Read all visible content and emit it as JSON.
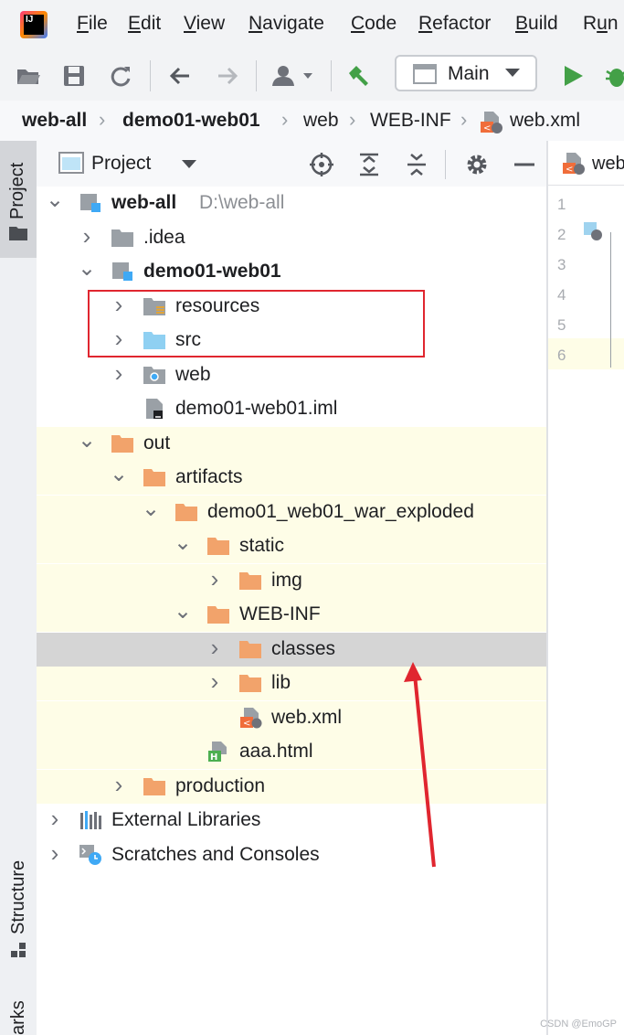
{
  "menu": {
    "app_logo": "IJ",
    "items": [
      {
        "pre": "",
        "ul": "F",
        "post": "ile"
      },
      {
        "pre": "",
        "ul": "E",
        "post": "dit"
      },
      {
        "pre": "",
        "ul": "V",
        "post": "iew"
      },
      {
        "pre": "",
        "ul": "N",
        "post": "avigate"
      },
      {
        "pre": "",
        "ul": "C",
        "post": "ode"
      },
      {
        "pre": "",
        "ul": "R",
        "post": "efactor"
      },
      {
        "pre": "",
        "ul": "B",
        "post": "uild"
      },
      {
        "pre": "R",
        "ul": "u",
        "post": "n"
      }
    ]
  },
  "toolbar": {
    "run_config": "Main",
    "icons": [
      "open-folder-icon",
      "save-icon",
      "sync-icon",
      "back-arrow-icon",
      "forward-arrow-icon",
      "user-icon",
      "build-hammer-icon",
      "run-icon",
      "debug-icon"
    ]
  },
  "breadcrumb": [
    "web-all",
    "demo01-web01",
    "web",
    "WEB-INF",
    "web.xml"
  ],
  "side_tabs": {
    "project": "Project",
    "structure": "Structure",
    "bookmarks": "arks"
  },
  "project_panel": {
    "title": "Project"
  },
  "tree": [
    {
      "label": "web-all",
      "hint": "D:\\web-all",
      "bold": true,
      "chevron": "expanded",
      "icon": "module"
    },
    {
      "label": ".idea",
      "chevron": "collapsed",
      "icon": "folder-gray"
    },
    {
      "label": "demo01-web01",
      "bold": true,
      "chevron": "expanded",
      "icon": "module"
    },
    {
      "label": "resources",
      "chevron": "collapsed",
      "icon": "resources-folder"
    },
    {
      "label": "src",
      "chevron": "collapsed",
      "icon": "source-folder"
    },
    {
      "label": "web",
      "chevron": "collapsed",
      "icon": "web-folder"
    },
    {
      "label": "demo01-web01.iml",
      "chevron": "none",
      "icon": "iml-file"
    },
    {
      "label": "out",
      "chevron": "expanded",
      "icon": "folder-orange"
    },
    {
      "label": "artifacts",
      "chevron": "expanded",
      "icon": "folder-orange"
    },
    {
      "label": "demo01_web01_war_exploded",
      "chevron": "expanded",
      "icon": "folder-orange"
    },
    {
      "label": "static",
      "chevron": "expanded",
      "icon": "folder-orange"
    },
    {
      "label": "img",
      "chevron": "collapsed",
      "icon": "folder-orange"
    },
    {
      "label": "WEB-INF",
      "chevron": "expanded",
      "icon": "folder-orange"
    },
    {
      "label": "classes",
      "chevron": "collapsed",
      "icon": "folder-orange"
    },
    {
      "label": "lib",
      "chevron": "collapsed",
      "icon": "folder-orange"
    },
    {
      "label": "web.xml",
      "chevron": "none",
      "icon": "xml-file"
    },
    {
      "label": "aaa.html",
      "chevron": "none",
      "icon": "html-file"
    },
    {
      "label": "production",
      "chevron": "collapsed",
      "icon": "folder-orange"
    },
    {
      "label": "External Libraries",
      "chevron": "collapsed",
      "icon": "libraries"
    },
    {
      "label": "Scratches and Consoles",
      "chevron": "collapsed",
      "icon": "scratches"
    }
  ],
  "editor": {
    "tab_label": "web",
    "line_numbers": [
      "1",
      "2",
      "3",
      "4",
      "5",
      "6"
    ]
  },
  "watermark": "CSDN @EmoGP",
  "colors": {
    "excluded_highlight": "#fefde7",
    "selected_row": "#d5d5d5",
    "annotation_red": "#e0262f",
    "folder_orange": "#f2a36b",
    "run_green": "#43a047"
  }
}
